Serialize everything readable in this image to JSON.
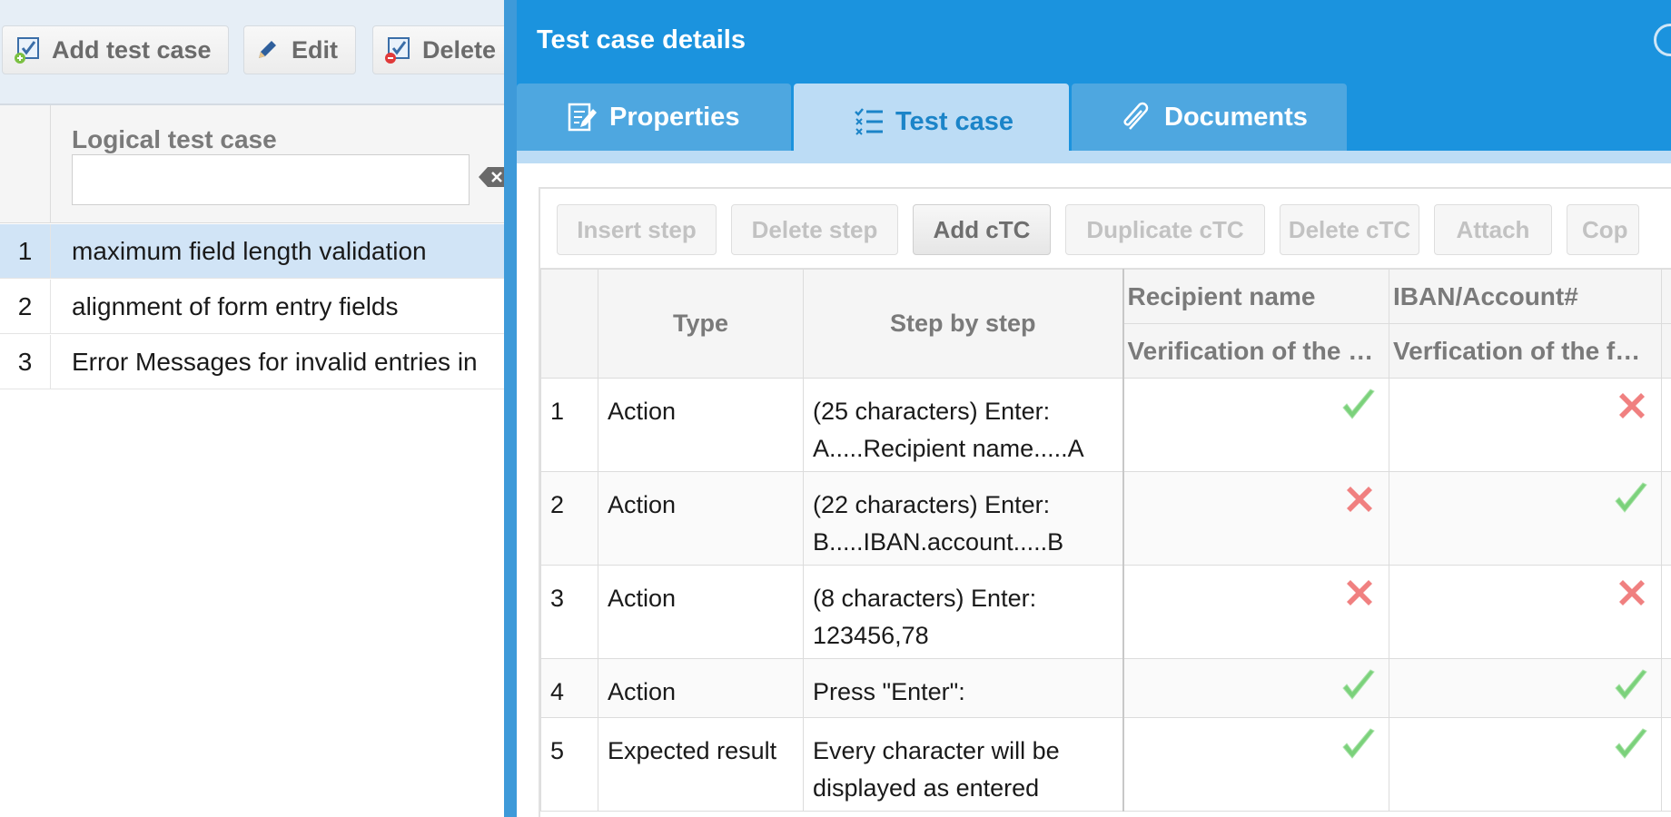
{
  "left_toolbar": {
    "add_label": "Add test case",
    "edit_label": "Edit",
    "delete_label": "Delete"
  },
  "left_grid": {
    "column_title": "Logical test case",
    "filter_value": "",
    "rows": [
      {
        "num": "1",
        "title": "maximum field length validation",
        "selected": true
      },
      {
        "num": "2",
        "title": "alignment of form entry fields",
        "selected": false
      },
      {
        "num": "3",
        "title": "Error Messages for invalid entries in",
        "selected": false
      }
    ]
  },
  "panel": {
    "title": "Test case details",
    "tabs": [
      {
        "label": "Properties",
        "icon": "edit-document-icon",
        "active": false
      },
      {
        "label": "Test case",
        "icon": "checklist-icon",
        "active": true
      },
      {
        "label": "Documents",
        "icon": "paperclip-icon",
        "active": false
      }
    ]
  },
  "step_toolbar": {
    "buttons": [
      {
        "label": "Insert step",
        "enabled": false
      },
      {
        "label": "Delete step",
        "enabled": false
      },
      {
        "label": "Add cTC",
        "enabled": true
      },
      {
        "label": "Duplicate cTC",
        "enabled": false
      },
      {
        "label": "Delete cTC",
        "enabled": false
      },
      {
        "label": "Attach",
        "enabled": false
      },
      {
        "label": "Cop",
        "enabled": false
      }
    ]
  },
  "steps_table": {
    "headers": {
      "type": "Type",
      "step": "Step by step",
      "ctc1_name": "Recipient name",
      "ctc1_desc": "Verification of the …",
      "ctc2_name": "IBAN/Account#",
      "ctc2_desc": "Verfication of the f…"
    },
    "rows": [
      {
        "num": "1",
        "type": "Action",
        "step": "(25 characters) Enter: A.....Recipient name.....A",
        "ctc1": "pass",
        "ctc2": "fail"
      },
      {
        "num": "2",
        "type": "Action",
        "step": "(22 characters) Enter: B.....IBAN.account.....B",
        "ctc1": "fail",
        "ctc2": "pass"
      },
      {
        "num": "3",
        "type": "Action",
        "step": "(8 characters) Enter: 123456,78",
        "ctc1": "fail",
        "ctc2": "fail"
      },
      {
        "num": "4",
        "type": "Action",
        "step": "Press \"Enter\":",
        "ctc1": "pass",
        "ctc2": "pass"
      },
      {
        "num": "5",
        "type": "Expected result",
        "step": "Every character will be displayed as entered",
        "ctc1": "pass",
        "ctc2": "pass"
      }
    ]
  },
  "colors": {
    "panel_header": "#1b93de",
    "active_tab": "#bcdcf5",
    "selected_row": "#d1e4f6",
    "check": "#7bd17b",
    "cross": "#f08080"
  }
}
